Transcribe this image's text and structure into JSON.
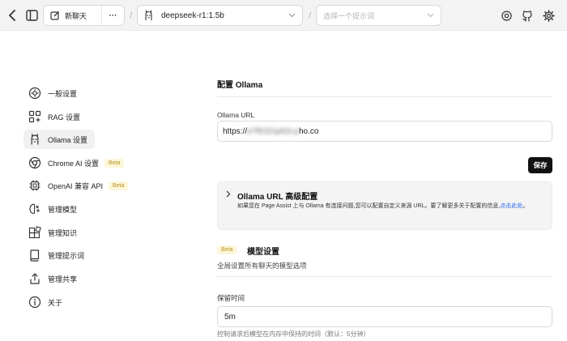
{
  "topbar": {
    "new_chat": "新聊天",
    "more": "···",
    "separator": "/",
    "model": "deepseek-r1:1.5b",
    "prompt_placeholder": "选择一个提示词"
  },
  "sidebar": {
    "items": [
      {
        "label": "一般设置",
        "icon": "gear-circle-icon"
      },
      {
        "label": "RAG 设置",
        "icon": "rag-icon"
      },
      {
        "label": "Ollama 设置",
        "icon": "ollama-icon",
        "active": true
      },
      {
        "label": "Chrome AI 设置",
        "icon": "chrome-icon",
        "badge": "Beta"
      },
      {
        "label": "OpenAI 兼容 API",
        "icon": "chip-icon",
        "badge": "Beta"
      },
      {
        "label": "管理模型",
        "icon": "brain-icon"
      },
      {
        "label": "管理知识",
        "icon": "blocks-icon"
      },
      {
        "label": "管理提示词",
        "icon": "book-icon"
      },
      {
        "label": "管理共享",
        "icon": "share-icon"
      },
      {
        "label": "关于",
        "icon": "info-icon"
      }
    ]
  },
  "main": {
    "title": "配置 Ollama",
    "url_label": "Ollama URL",
    "url_prefix": "https://",
    "url_hidden": "e7f6151p62r.p",
    "url_suffix": "ho.co",
    "save": "保存",
    "advanced": {
      "title": "Ollama URL 高级配置",
      "desc": "如果您在 Page Assist 上与 Ollama 有连接问题,您可以配置自定义来源 URL。要了解更多关于配置的信息,",
      "link": "点击此处",
      "desc_end": "。"
    },
    "model_settings": {
      "badge": "Beta",
      "title": "模型设置",
      "subtitle": "全局设置所有聊天的模型选项"
    },
    "keep_alive": {
      "label": "保留时间",
      "value": "5m",
      "hint": "控制请求后模型在内存中保持的时间（默认：5分钟）"
    }
  },
  "colors": {
    "accent": "#111111",
    "beta_bg": "#fdf6d8",
    "beta_fg": "#b79224",
    "link": "#2563eb"
  }
}
